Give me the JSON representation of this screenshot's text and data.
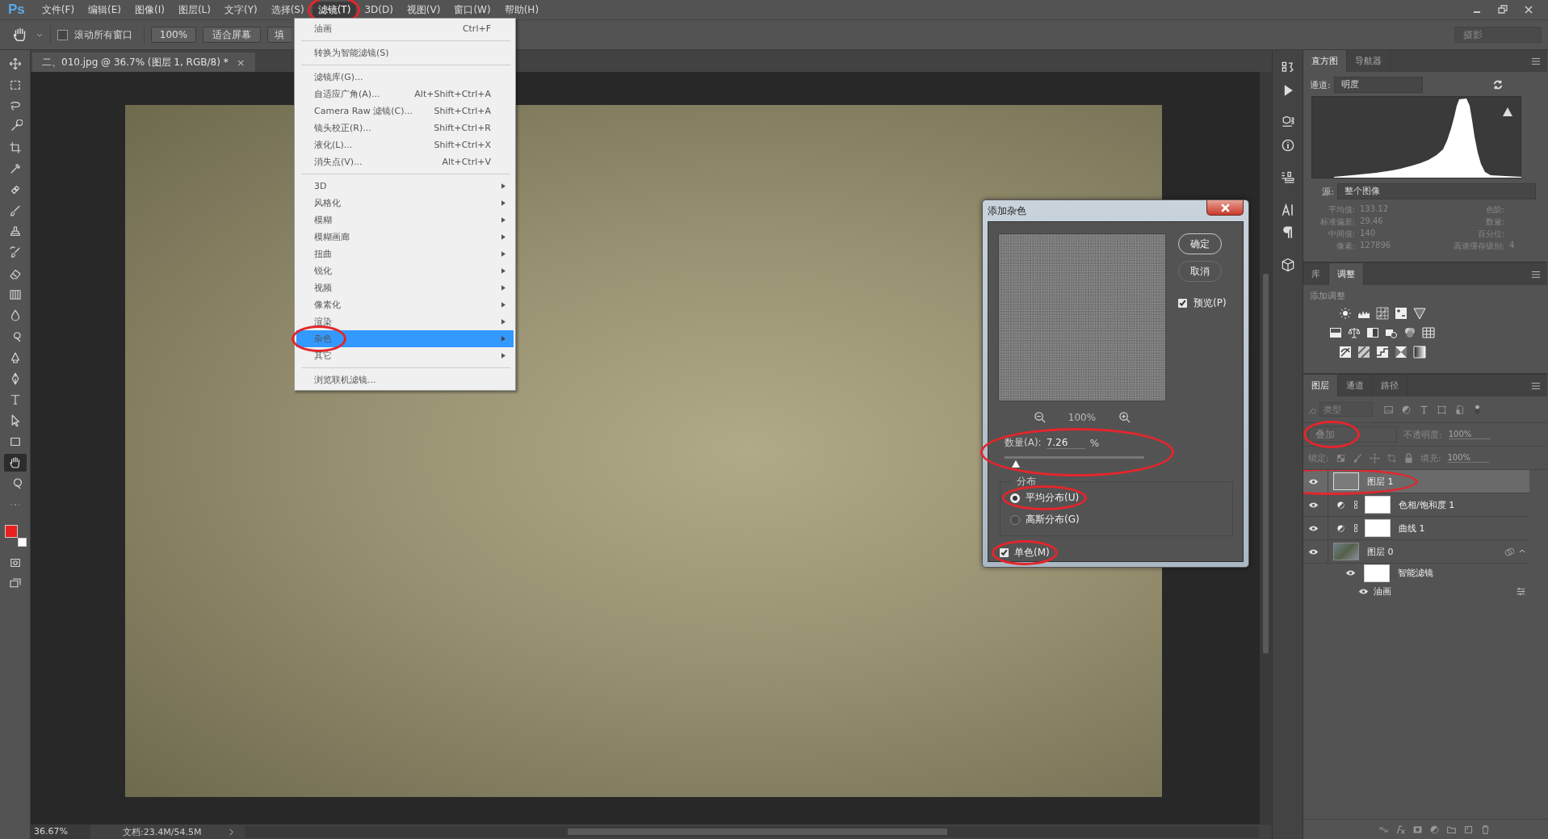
{
  "menu_bar": {
    "logo": "Ps",
    "items": [
      {
        "label": "文件(F)",
        "selected": false
      },
      {
        "label": "编辑(E)",
        "selected": false
      },
      {
        "label": "图像(I)",
        "selected": false
      },
      {
        "label": "图层(L)",
        "selected": false
      },
      {
        "label": "文字(Y)",
        "selected": false
      },
      {
        "label": "选择(S)",
        "selected": false
      },
      {
        "label": "滤镜(T)",
        "selected": true,
        "circled": true
      },
      {
        "label": "3D(D)",
        "selected": false
      },
      {
        "label": "视图(V)",
        "selected": false
      },
      {
        "label": "窗口(W)",
        "selected": false
      },
      {
        "label": "帮助(H)",
        "selected": false
      }
    ]
  },
  "options_bar": {
    "scroll_all": {
      "label": "滚动所有窗口",
      "checked": false
    },
    "buttons": [
      "100%",
      "适合屏幕",
      "填"
    ],
    "workspace": "摄影"
  },
  "document_tab": {
    "title": "二、010.jpg @ 36.7% (图层 1, RGB/8) *",
    "close": "×"
  },
  "toolbar": {
    "tools": [
      {
        "selected": false
      },
      {
        "selected": false
      },
      {
        "selected": false
      },
      {
        "selected": false
      },
      {
        "selected": false
      },
      {
        "selected": false
      },
      {
        "selected": false
      },
      {
        "selected": false
      },
      {
        "selected": false
      },
      {
        "selected": false
      },
      {
        "selected": false
      },
      {
        "selected": false
      },
      {
        "selected": false
      },
      {
        "selected": false
      },
      {
        "selected": false
      },
      {
        "selected": false
      },
      {
        "selected": false
      },
      {
        "selected": false
      },
      {
        "selected": false
      },
      {
        "selected": true
      },
      {
        "selected": false
      },
      {
        "selected": false
      }
    ],
    "swatches": [
      {
        "color": "#e8211f"
      },
      {
        "color": "#ffffff"
      }
    ]
  },
  "filter_menu": {
    "items": [
      {
        "kind": "item",
        "label": "油画",
        "shortcut": "Ctrl+F",
        "selected": false
      },
      {
        "kind": "separator"
      },
      {
        "kind": "item",
        "label": "转换为智能滤镜(S)",
        "selected": false
      },
      {
        "kind": "separator"
      },
      {
        "kind": "item",
        "label": "滤镜库(G)...",
        "selected": false
      },
      {
        "kind": "item",
        "label": "自适应广角(A)...",
        "shortcut": "Alt+Shift+Ctrl+A",
        "selected": false
      },
      {
        "kind": "item",
        "label": "Camera Raw 滤镜(C)...",
        "shortcut": "Shift+Ctrl+A",
        "selected": false
      },
      {
        "kind": "item",
        "label": "镜头校正(R)...",
        "shortcut": "Shift+Ctrl+R",
        "selected": false
      },
      {
        "kind": "item",
        "label": "液化(L)...",
        "shortcut": "Shift+Ctrl+X",
        "selected": false
      },
      {
        "kind": "item",
        "label": "消失点(V)...",
        "shortcut": "Alt+Ctrl+V",
        "selected": false
      },
      {
        "kind": "separator"
      },
      {
        "kind": "submenu",
        "label": "3D",
        "selected": false
      },
      {
        "kind": "submenu",
        "label": "风格化",
        "selected": false
      },
      {
        "kind": "submenu",
        "label": "模糊",
        "selected": false
      },
      {
        "kind": "submenu",
        "label": "模糊画廊",
        "selected": false
      },
      {
        "kind": "submenu",
        "label": "扭曲",
        "selected": false
      },
      {
        "kind": "submenu",
        "label": "锐化",
        "selected": false
      },
      {
        "kind": "submenu",
        "label": "视频",
        "selected": false
      },
      {
        "kind": "submenu",
        "label": "像素化",
        "selected": false
      },
      {
        "kind": "submenu",
        "label": "渲染",
        "selected": false
      },
      {
        "kind": "submenu",
        "label": "杂色",
        "selected": true,
        "circled": true
      },
      {
        "kind": "submenu",
        "label": "其它",
        "selected": false
      },
      {
        "kind": "separator"
      },
      {
        "kind": "item",
        "label": "浏览联机滤镜...",
        "selected": false
      }
    ]
  },
  "dialog": {
    "title": "添加杂色",
    "buttons": [
      "确定",
      "取消"
    ],
    "preview": {
      "label": "预览(P)",
      "checked": true
    },
    "zoom": "100%",
    "amount": {
      "label": "数量(A):",
      "value": "7.26",
      "unit": "%",
      "level": 0.08,
      "circled": true
    },
    "distribution": {
      "label": "分布",
      "options": [
        {
          "label": "平均分布(U)",
          "selected": true,
          "circled": true
        },
        {
          "label": "高斯分布(G)",
          "selected": false
        }
      ]
    },
    "monochrome": {
      "label": "单色(M)",
      "checked": true,
      "circled": true
    }
  },
  "histogram_panel": {
    "tabs": [
      {
        "label": "直方图",
        "selected": true
      },
      {
        "label": "导航器",
        "selected": false
      }
    ],
    "channel": {
      "label": "通道:",
      "value": "明度"
    },
    "source": {
      "label": "源:",
      "value": "整个图像"
    },
    "stats_left": [
      {
        "label": "平均值:",
        "value": "133.12"
      },
      {
        "label": "标准偏差:",
        "value": "29.46"
      },
      {
        "label": "中间值:",
        "value": "140"
      },
      {
        "label": "像素:",
        "value": "127896"
      }
    ],
    "stats_right": [
      {
        "label": "色阶:"
      },
      {
        "label": "数量:"
      },
      {
        "label": "百分位:"
      },
      {
        "label": "高速缓存级别:",
        "value": "4"
      }
    ]
  },
  "adjustments_panel": {
    "tabs": [
      {
        "label": "库",
        "selected": false
      },
      {
        "label": "调整",
        "selected": true
      }
    ],
    "heading": "添加调整"
  },
  "layers_panel": {
    "tabs": [
      {
        "label": "图层",
        "selected": true
      },
      {
        "label": "通道",
        "selected": false
      },
      {
        "label": "路径",
        "selected": false
      }
    ],
    "filter": {
      "placeholder": "类型"
    },
    "blend_mode": {
      "value": "叠加",
      "circled": true
    },
    "opacity": {
      "label": "不透明度:",
      "value": "100%"
    },
    "lock_label": "锁定:",
    "fill": {
      "label": "填充:",
      "value": "100%"
    },
    "layers": [
      {
        "kind": "pixel",
        "name": "图层 1",
        "visible": true,
        "selected": true,
        "circled": true
      },
      {
        "kind": "adjustment",
        "name": "色相/饱和度 1",
        "visible": true,
        "selected": false
      },
      {
        "kind": "adjustment",
        "name": "曲线 1",
        "visible": true,
        "selected": false
      },
      {
        "kind": "smart",
        "name": "图层 0",
        "visible": true,
        "selected": false,
        "expanded": true,
        "children": [
          {
            "kind": "smart_filters",
            "name": "智能滤镜",
            "visible": true,
            "selected": false,
            "children": [
              {
                "kind": "filter",
                "name": "油画",
                "visible": true,
                "selected": false
              }
            ]
          }
        ]
      }
    ]
  },
  "status_bar": {
    "zoom": "36.67%",
    "document": "文档:23.4M/54.5M"
  }
}
